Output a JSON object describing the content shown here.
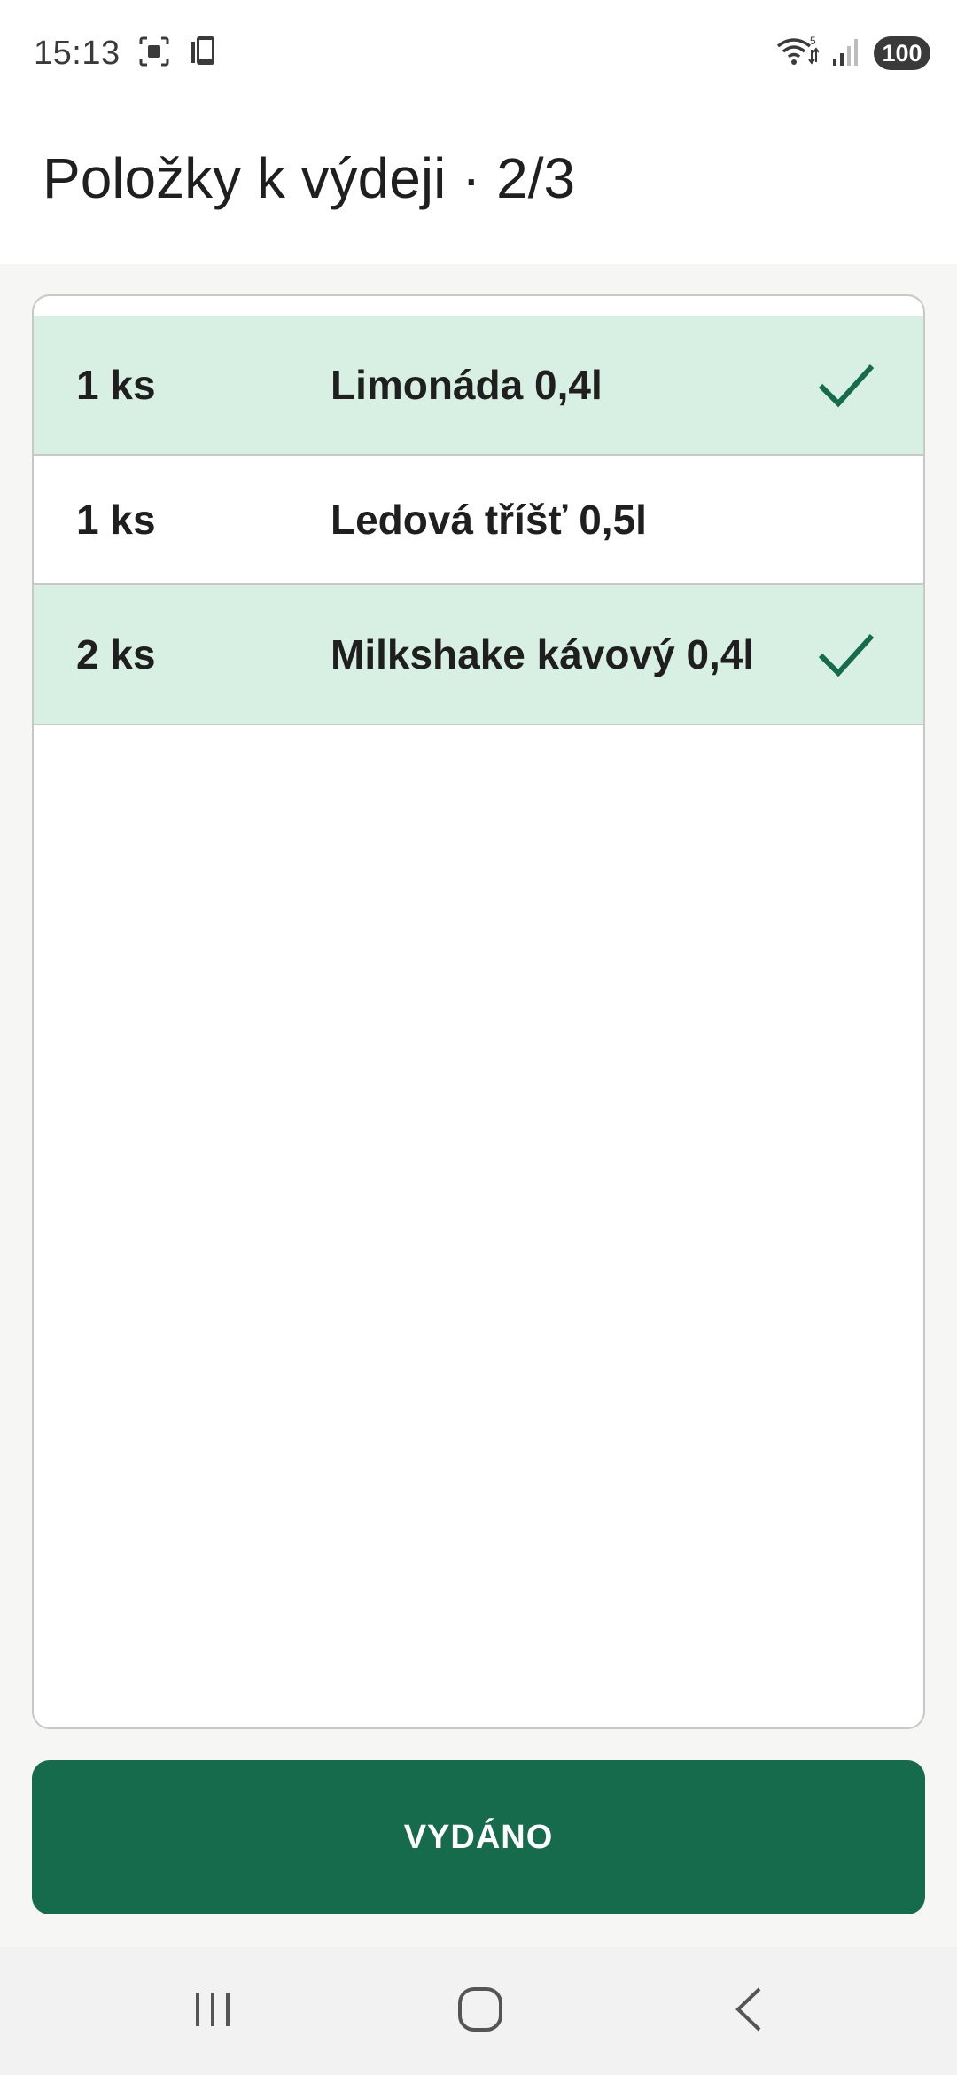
{
  "status_bar": {
    "time": "15:13",
    "battery": "100",
    "icons": [
      "screenshot-icon",
      "phone-icon",
      "wifi-icon",
      "signal-icon"
    ]
  },
  "header": {
    "title": "Položky k výdeji · 2/3"
  },
  "items": [
    {
      "qty": "1 ks",
      "name": "Limonáda 0,4l",
      "done": true
    },
    {
      "qty": "1 ks",
      "name": "Ledová tříšť 0,5l",
      "done": false
    },
    {
      "qty": "2 ks",
      "name": "Milkshake kávový 0,4l",
      "done": true
    }
  ],
  "action": {
    "label": "VYDÁNO"
  },
  "colors": {
    "accent": "#176b4d",
    "done_row": "#d8efe3",
    "check": "#176b4d"
  },
  "nav": {
    "icons": [
      "recent-apps-icon",
      "home-icon",
      "back-icon"
    ]
  }
}
